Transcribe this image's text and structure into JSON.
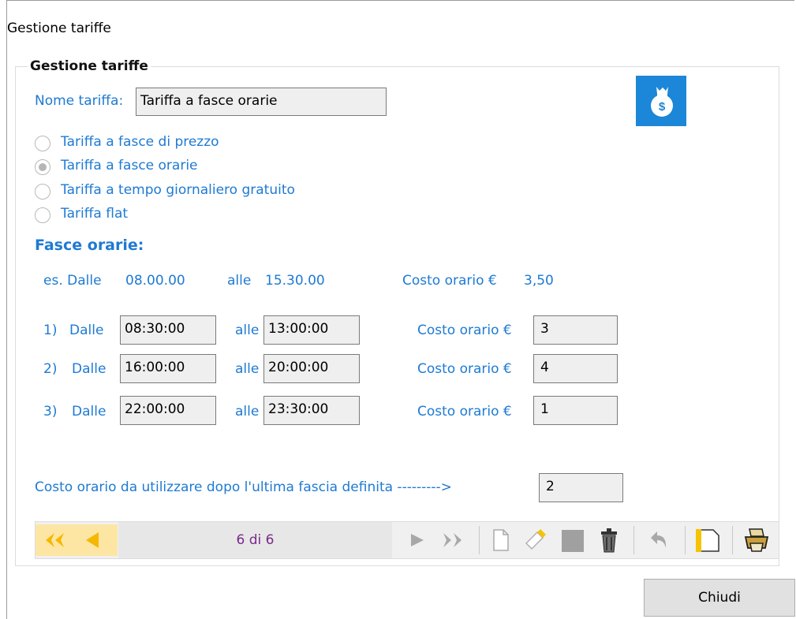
{
  "window": {
    "title": "Gestione tariffe"
  },
  "group": {
    "title": "Gestione tariffe"
  },
  "nome": {
    "label": "Nome tariffa:",
    "value": "Tariffa a fasce orarie"
  },
  "radios": [
    {
      "label": "Tariffa a fasce di prezzo",
      "selected": false
    },
    {
      "label": "Tariffa a fasce orarie",
      "selected": true
    },
    {
      "label": "Tariffa a tempo giornaliero gratuito",
      "selected": false
    },
    {
      "label": "Tariffa flat",
      "selected": false
    }
  ],
  "fasce": {
    "heading": "Fasce orarie:",
    "example": {
      "prefix": "es. Dalle",
      "from": "08.00.00",
      "alle": "alle",
      "to": "15.30.00",
      "cost_label": "Costo orario  €",
      "cost": "3,50"
    },
    "rows": [
      {
        "num": "1)",
        "dalle": "Dalle",
        "from": "08:30:00",
        "alle": "alle",
        "to": "13:00:00",
        "cost_label": "Costo orario  €",
        "cost": "3"
      },
      {
        "num": "2)",
        "dalle": "Dalle",
        "from": "16:00:00",
        "alle": "alle",
        "to": "20:00:00",
        "cost_label": "Costo orario  €",
        "cost": "4"
      },
      {
        "num": "3)",
        "dalle": "Dalle",
        "from": "22:00:00",
        "alle": "alle",
        "to": "23:30:00",
        "cost_label": "Costo orario  €",
        "cost": "1"
      }
    ]
  },
  "after": {
    "label": "Costo orario da utilizzare dopo l'ultima fascia definita --------->",
    "value": "2"
  },
  "navigator": {
    "position": "6 di 6",
    "icons": [
      "first-record-icon",
      "prev-record-icon",
      "next-record-icon",
      "last-record-icon",
      "new-record-icon",
      "edit-record-icon",
      "save-record-icon",
      "delete-record-icon",
      "undo-icon",
      "bookmark-icon",
      "print-icon"
    ]
  },
  "buttons": {
    "close": "Chiudi"
  },
  "colors": {
    "accent": "#1e7ad3",
    "icon_bg": "#1c86d8",
    "nav_highlight": "#fde6a4",
    "nav_arrow": "#f5b800",
    "position_text": "#7a2a8a"
  }
}
